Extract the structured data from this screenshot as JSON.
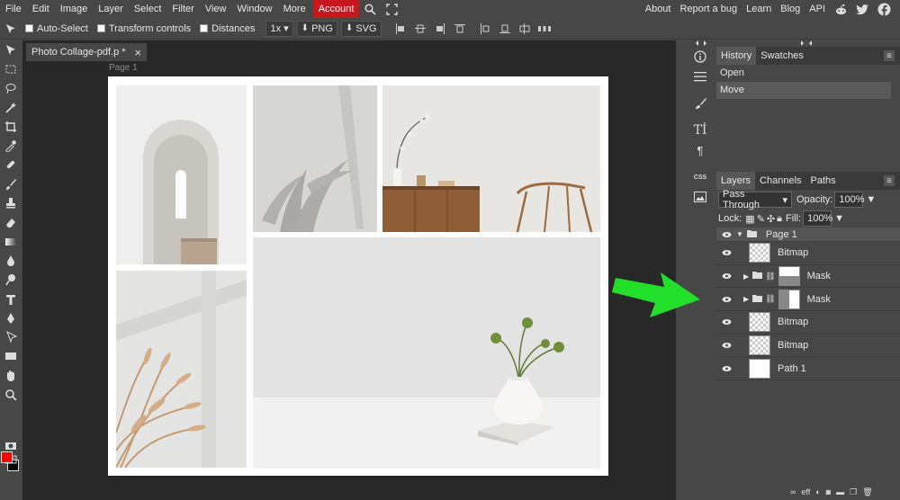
{
  "menu": {
    "items": [
      "File",
      "Edit",
      "Image",
      "Layer",
      "Select",
      "Filter",
      "View",
      "Window",
      "More"
    ],
    "account_label": "Account",
    "right_links": [
      "About",
      "Report a bug",
      "Learn",
      "Blog",
      "API"
    ]
  },
  "options": {
    "auto_select": "Auto-Select",
    "transform_controls": "Transform controls",
    "distances": "Distances",
    "scale": "1x",
    "png": "PNG",
    "svg": "SVG"
  },
  "document": {
    "tab_title": "Photo Collage-pdf.p",
    "tab_modified": "*",
    "close_glyph": "×",
    "page_label": "Page 1"
  },
  "history": {
    "tabs": [
      "History",
      "Swatches"
    ],
    "entries": [
      "Open",
      "Move"
    ],
    "selected_index": 1
  },
  "layers": {
    "tabs": [
      "Layers",
      "Channels",
      "Paths"
    ],
    "blend_mode": "Pass Through",
    "opacity_label": "Opacity:",
    "opacity_value": "100%",
    "lock_label": "Lock:",
    "fill_label": "Fill:",
    "fill_value": "100%",
    "group_name": "Page 1",
    "items": [
      {
        "name": "Bitmap",
        "type": "bitmap"
      },
      {
        "name": "Mask",
        "type": "mask-group"
      },
      {
        "name": "Mask",
        "type": "mask-group"
      },
      {
        "name": "Bitmap",
        "type": "bitmap"
      },
      {
        "name": "Bitmap",
        "type": "bitmap"
      },
      {
        "name": "Path 1",
        "type": "path"
      }
    ]
  },
  "colors": {
    "foreground": "#ff0000",
    "background": "#000000",
    "account_bg": "#c8171e",
    "annotation_arrow": "#22e02a"
  }
}
